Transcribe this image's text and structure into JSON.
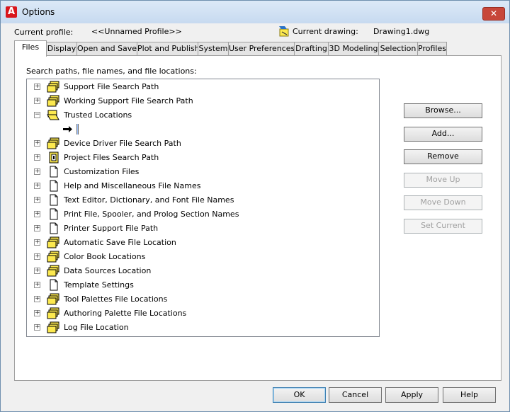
{
  "window": {
    "title": "Options",
    "close_glyph": "✕",
    "app_icon_letter": "A"
  },
  "profile": {
    "label": "Current profile:",
    "value": "<<Unnamed Profile>>"
  },
  "drawing": {
    "label": "Current drawing:",
    "value": "Drawing1.dwg"
  },
  "tabs": [
    {
      "label": "Files",
      "active": true
    },
    {
      "label": "Display"
    },
    {
      "label": "Open and Save"
    },
    {
      "label": "Plot and Publish"
    },
    {
      "label": "System"
    },
    {
      "label": "User Preferences"
    },
    {
      "label": "Drafting"
    },
    {
      "label": "3D Modeling"
    },
    {
      "label": "Selection"
    },
    {
      "label": "Profiles"
    }
  ],
  "files": {
    "section_label": "Search paths, file names, and file locations:",
    "tree": [
      {
        "label": "Support File Search Path",
        "icon": "folder-stack-icon",
        "expander": "+"
      },
      {
        "label": "Working Support File Search Path",
        "icon": "folder-stack-icon",
        "expander": "+"
      },
      {
        "label": "Trusted Locations",
        "icon": "folder-open-icon",
        "expander": "−"
      },
      {
        "label": "",
        "icon": "arrow-cursor-icon",
        "child": true
      },
      {
        "label": "Device Driver File Search Path",
        "icon": "folder-stack-icon",
        "expander": "+"
      },
      {
        "label": "Project Files Search Path",
        "icon": "project-icon",
        "expander": "+"
      },
      {
        "label": "Customization Files",
        "icon": "document-icon",
        "expander": "+"
      },
      {
        "label": "Help and Miscellaneous File Names",
        "icon": "document-icon",
        "expander": "+"
      },
      {
        "label": "Text Editor, Dictionary, and Font File Names",
        "icon": "document-icon",
        "expander": "+"
      },
      {
        "label": "Print File, Spooler, and Prolog Section Names",
        "icon": "document-icon",
        "expander": "+"
      },
      {
        "label": "Printer Support File Path",
        "icon": "document-icon",
        "expander": "+"
      },
      {
        "label": "Automatic Save File Location",
        "icon": "folder-stack-icon",
        "expander": "+"
      },
      {
        "label": "Color Book Locations",
        "icon": "folder-stack-icon",
        "expander": "+"
      },
      {
        "label": "Data Sources Location",
        "icon": "folder-stack-icon",
        "expander": "+"
      },
      {
        "label": "Template Settings",
        "icon": "document-icon",
        "expander": "+"
      },
      {
        "label": "Tool Palettes File Locations",
        "icon": "folder-stack-icon",
        "expander": "+"
      },
      {
        "label": "Authoring Palette File Locations",
        "icon": "folder-stack-icon",
        "expander": "+"
      },
      {
        "label": "Log File Location",
        "icon": "folder-stack-icon",
        "expander": "+"
      }
    ],
    "buttons": {
      "browse": "Browse...",
      "add": "Add...",
      "remove": "Remove",
      "move_up": "Move Up",
      "move_down": "Move Down",
      "set_current": "Set Current"
    }
  },
  "footer": {
    "ok": "OK",
    "cancel": "Cancel",
    "apply": "Apply",
    "help": "Help"
  },
  "scrollbar": {
    "up_glyph": "▲",
    "down_glyph": "▼"
  },
  "colors": {
    "folder_yellow": "#fce94f",
    "accent_red": "#d9161c"
  }
}
